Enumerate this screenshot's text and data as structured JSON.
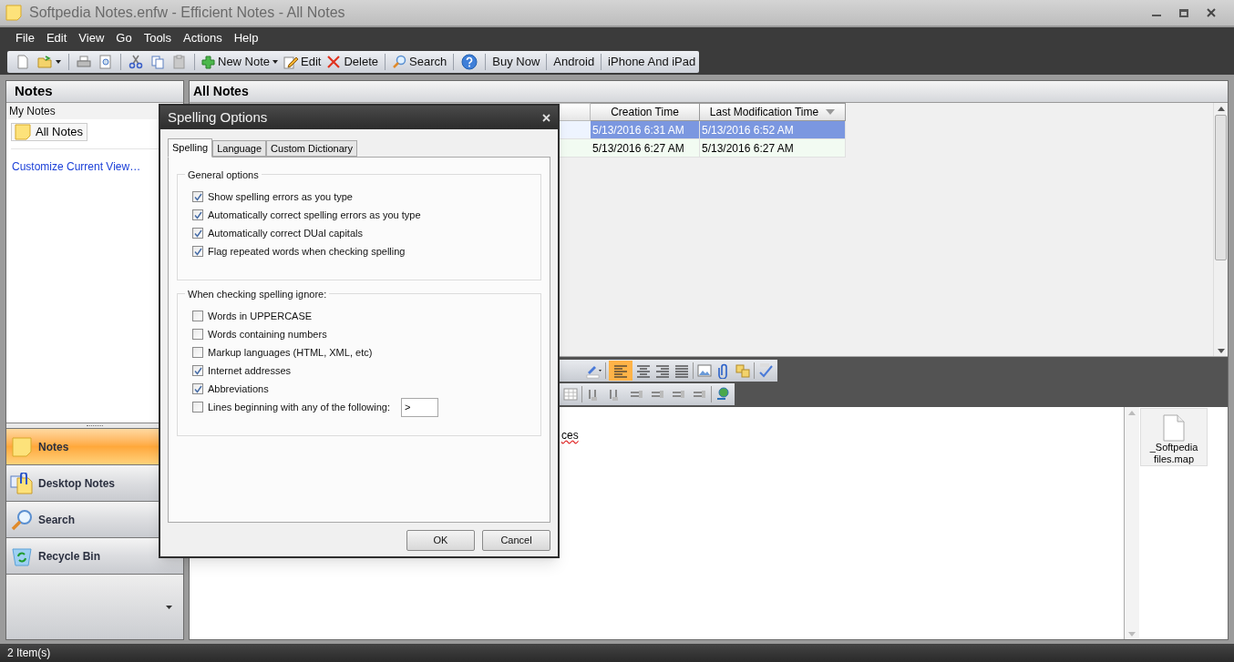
{
  "window": {
    "title": "Softpedia Notes.enfw - Efficient Notes - All Notes"
  },
  "menu": [
    "File",
    "Edit",
    "View",
    "Go",
    "Tools",
    "Actions",
    "Help"
  ],
  "toolbar": {
    "buttons": [
      {
        "label": "New Note",
        "dropdown": true
      },
      {
        "label": "Edit",
        "dropdown": false
      },
      {
        "label": "Delete",
        "dropdown": false
      },
      {
        "label": "Search",
        "dropdown": false
      }
    ],
    "links": [
      "Buy Now",
      "Android",
      "iPhone And iPad"
    ]
  },
  "sidebar": {
    "header": "Notes",
    "section": "My Notes",
    "items": [
      {
        "label": "All Notes",
        "selected": true
      }
    ],
    "link": "Customize Current View…",
    "nav": [
      {
        "label": "Notes",
        "selected": true
      },
      {
        "label": "Desktop Notes",
        "selected": false
      },
      {
        "label": "Search",
        "selected": false
      },
      {
        "label": "Recycle Bin",
        "selected": false
      }
    ]
  },
  "main": {
    "header": "All Notes",
    "table": {
      "columns": [
        {
          "label": "Creation Time",
          "sorted": false
        },
        {
          "label": "Last Modification Time",
          "sorted": true
        }
      ],
      "rows": [
        {
          "cells": [
            "5/13/2016 6:31 AM",
            "5/13/2016 6:52 AM"
          ],
          "selected": true
        },
        {
          "cells": [
            "5/13/2016 6:27 AM",
            "5/13/2016 6:27 AM"
          ],
          "selected": false
        }
      ]
    }
  },
  "editor": {
    "text": "ces"
  },
  "attachments": [
    {
      "name": "_Softpedia files.map"
    }
  ],
  "status_bar": "2 Item(s)",
  "dialog": {
    "title": "Spelling Options",
    "tabs": [
      {
        "label": "Spelling",
        "selected": true
      },
      {
        "label": "Language",
        "selected": false
      },
      {
        "label": "Custom Dictionary",
        "selected": false
      }
    ],
    "groups": [
      {
        "title": "General options",
        "options": [
          {
            "label": "Show spelling errors as you type",
            "checked": true
          },
          {
            "label": "Automatically correct spelling errors as you type",
            "checked": true
          },
          {
            "label": "Automatically correct DUal capitals",
            "checked": true
          },
          {
            "label": "Flag repeated words when checking spelling",
            "checked": true
          }
        ]
      },
      {
        "title": "When checking spelling ignore:",
        "options": [
          {
            "label": "Words in UPPERCASE",
            "checked": false
          },
          {
            "label": "Words containing numbers",
            "checked": false
          },
          {
            "label": "Markup languages (HTML, XML, etc)",
            "checked": false
          },
          {
            "label": "Internet addresses",
            "checked": true
          },
          {
            "label": "Abbreviations",
            "checked": true
          },
          {
            "label": "Lines beginning with any of the following:",
            "checked": false,
            "value": ">"
          }
        ]
      }
    ],
    "buttons": [
      "OK",
      "Cancel"
    ]
  }
}
